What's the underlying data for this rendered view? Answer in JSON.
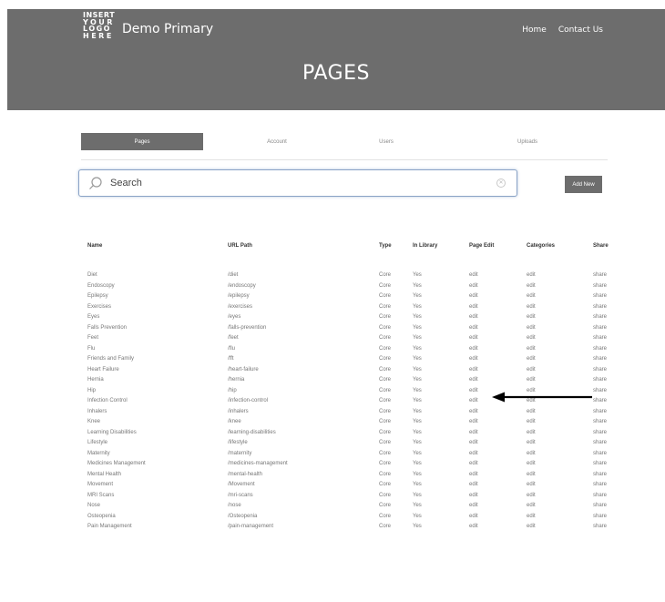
{
  "header": {
    "logo_lines": [
      "INSERT",
      "YOUR",
      "LOGO",
      "HERE"
    ],
    "brand": "Demo Primary",
    "nav": [
      "Home",
      "Contact Us"
    ],
    "title": "PAGES",
    "background_color": "#6d6d6d"
  },
  "tabs": [
    {
      "label": "Pages",
      "active": true
    },
    {
      "label": "Account",
      "active": false
    },
    {
      "label": "Users",
      "active": false
    },
    {
      "label": "Uploads",
      "active": false
    }
  ],
  "search": {
    "placeholder": "Search",
    "icon": "search-icon",
    "clear_icon": "clear-icon"
  },
  "add_button": "Add New",
  "table": {
    "columns": [
      "Name",
      "URL Path",
      "Type",
      "In Library",
      "Page Edit",
      "Categories",
      "Share"
    ],
    "rows": [
      [
        "Diet",
        "/diet",
        "Core",
        "Yes",
        "edit",
        "edit",
        "share"
      ],
      [
        "Endoscopy",
        "/endoscopy",
        "Core",
        "Yes",
        "edit",
        "edit",
        "share"
      ],
      [
        "Epilepsy",
        "/epilepsy",
        "Core",
        "Yes",
        "edit",
        "edit",
        "share"
      ],
      [
        "Exercises",
        "/exercises",
        "Core",
        "Yes",
        "edit",
        "edit",
        "share"
      ],
      [
        "Eyes",
        "/eyes",
        "Core",
        "Yes",
        "edit",
        "edit",
        "share"
      ],
      [
        "Falls Prevention",
        "/falls-prevention",
        "Core",
        "Yes",
        "edit",
        "edit",
        "share"
      ],
      [
        "Feet",
        "/feet",
        "Core",
        "Yes",
        "edit",
        "edit",
        "share"
      ],
      [
        "Flu",
        "/flu",
        "Core",
        "Yes",
        "edit",
        "edit",
        "share"
      ],
      [
        "Friends and Family",
        "/fft",
        "Core",
        "Yes",
        "edit",
        "edit",
        "share"
      ],
      [
        "Heart Failure",
        "/heart-failure",
        "Core",
        "Yes",
        "edit",
        "edit",
        "share"
      ],
      [
        "Hernia",
        "/hernia",
        "Core",
        "Yes",
        "edit",
        "edit",
        "share"
      ],
      [
        "Hip",
        "/hip",
        "Core",
        "Yes",
        "edit",
        "edit",
        "share"
      ],
      [
        "Infection Control",
        "/infection-control",
        "Core",
        "Yes",
        "edit",
        "edit",
        "share"
      ],
      [
        "Inhalers",
        "/inhalers",
        "Core",
        "Yes",
        "edit",
        "edit",
        "share"
      ],
      [
        "Knee",
        "/knee",
        "Core",
        "Yes",
        "edit",
        "edit",
        "share"
      ],
      [
        "Learning Disabilities",
        "/learning-disabilities",
        "Core",
        "Yes",
        "edit",
        "edit",
        "share"
      ],
      [
        "Lifestyle",
        "/lifestyle",
        "Core",
        "Yes",
        "edit",
        "edit",
        "share"
      ],
      [
        "Maternity",
        "/maternity",
        "Core",
        "Yes",
        "edit",
        "edit",
        "share"
      ],
      [
        "Medicines Management",
        "/medicines-management",
        "Core",
        "Yes",
        "edit",
        "edit",
        "share"
      ],
      [
        "Mental Health",
        "/mental-health",
        "Core",
        "Yes",
        "edit",
        "edit",
        "share"
      ],
      [
        "Movement",
        "/Movement",
        "Core",
        "Yes",
        "edit",
        "edit",
        "share"
      ],
      [
        "MRI Scans",
        "/mri-scans",
        "Core",
        "Yes",
        "edit",
        "edit",
        "share"
      ],
      [
        "Nose",
        "/nose",
        "Core",
        "Yes",
        "edit",
        "edit",
        "share"
      ],
      [
        "Osteopenia",
        "/Osteopenia",
        "Core",
        "Yes",
        "edit",
        "edit",
        "share"
      ],
      [
        "Pain Management",
        "/pain-management",
        "Core",
        "Yes",
        "edit",
        "edit",
        "share"
      ]
    ]
  },
  "annotation": {
    "icon": "arrow-left-icon",
    "color": "#000000"
  }
}
